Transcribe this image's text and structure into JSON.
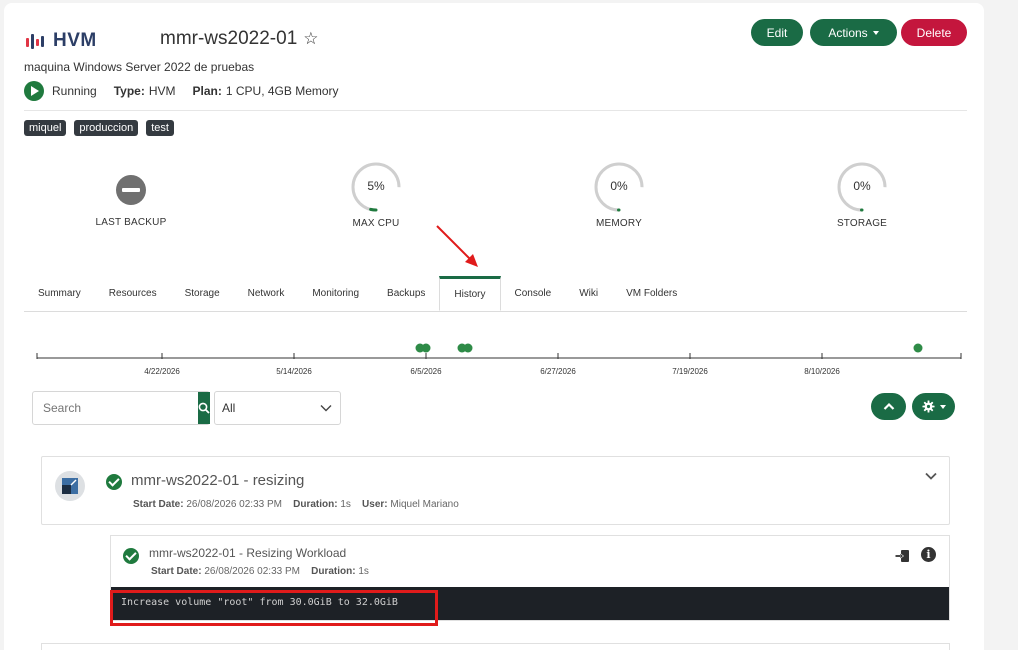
{
  "header": {
    "logo_text": "HVM",
    "vm_name": "mmr-ws2022-01",
    "description": "maquina Windows Server 2022 de pruebas",
    "status": "Running",
    "type_label": "Type:",
    "type_value": "HVM",
    "plan_label": "Plan:",
    "plan_value": "1 CPU, 4GB Memory"
  },
  "buttons": {
    "edit": "Edit",
    "actions": "Actions",
    "delete": "Delete"
  },
  "tags": [
    "miquel",
    "produccion",
    "test"
  ],
  "metrics": [
    {
      "label": "LAST BACKUP"
    },
    {
      "label": "MAX CPU",
      "value": "5%",
      "fraction": 0.05
    },
    {
      "label": "MEMORY",
      "value": "0%",
      "fraction": 0
    },
    {
      "label": "STORAGE",
      "value": "0%",
      "fraction": 0
    }
  ],
  "tabs": [
    "Summary",
    "Resources",
    "Storage",
    "Network",
    "Monitoring",
    "Backups",
    "History",
    "Console",
    "Wiki",
    "VM Folders"
  ],
  "active_tab": "History",
  "timeline": {
    "ticks": [
      "4/22/2026",
      "5/14/2026",
      "6/5/2026",
      "6/27/2026",
      "7/19/2026",
      "8/10/2026"
    ],
    "events": [
      "2026-06-04",
      "2026-06-05",
      "2026-06-11",
      "2026-06-12",
      "2026-08-26"
    ]
  },
  "filters": {
    "search_placeholder": "Search",
    "select_value": "All"
  },
  "history": {
    "title": "mmr-ws2022-01 - resizing",
    "start_label": "Start Date:",
    "start_value": "26/08/2026 02:33 PM",
    "duration_label": "Duration:",
    "duration_value": "1s",
    "user_label": "User:",
    "user_value": "Miquel Mariano",
    "sub": {
      "title": "mmr-ws2022-01 - Resizing Workload",
      "start_label": "Start Date:",
      "start_value": "26/08/2026 02:33 PM",
      "duration_label": "Duration:",
      "duration_value": "1s",
      "output": "Increase volume \"root\" from 30.0GiB to 32.0GiB"
    }
  },
  "colors": {
    "primary": "#1a6b45",
    "danger": "#c4163d",
    "success": "#1f7a3e",
    "annotation": "#e01b1b"
  }
}
